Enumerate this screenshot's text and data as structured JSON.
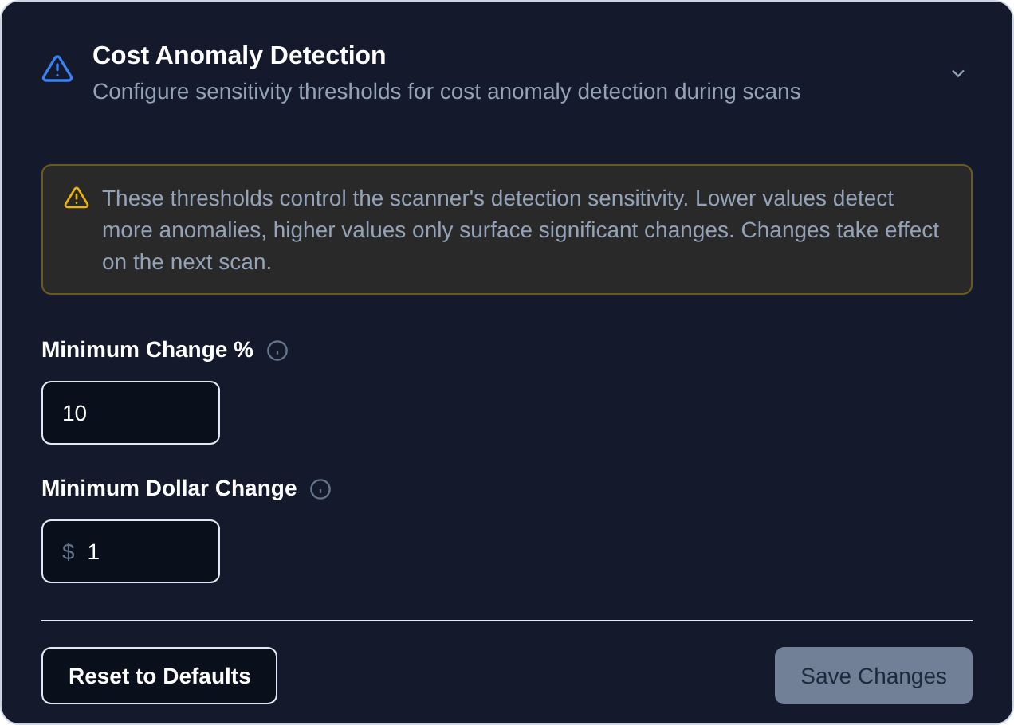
{
  "header": {
    "title": "Cost Anomaly Detection",
    "subtitle": "Configure sensitivity thresholds for cost anomaly detection during scans",
    "expanded": true
  },
  "notice": "These thresholds control the scanner's detection sensitivity. Lower values detect more anomalies, higher values only surface significant changes. Changes take effect on the next scan.",
  "fields": [
    {
      "label": "Minimum Change %",
      "value": "10"
    },
    {
      "label": "Minimum Dollar Change",
      "prefix": "$",
      "value": "1"
    }
  ],
  "buttons": [
    {
      "label": "Reset to Defaults",
      "kind": "secondary",
      "disabled": false
    },
    {
      "label": "Save Changes",
      "kind": "primary",
      "disabled": true
    }
  ]
}
